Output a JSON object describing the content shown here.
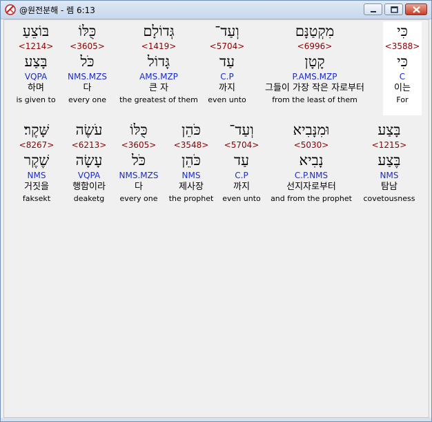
{
  "window": {
    "title": "@원전분해 - 렘 6:13"
  },
  "rows": [
    {
      "words": [
        {
          "heb": "כִּי",
          "strong": "<3588>",
          "lemma": "כִּי",
          "morph": "C",
          "kor": "이는",
          "eng": "For",
          "selected": true
        },
        {
          "heb": "מִקְטַנָּם",
          "strong": "<6996>",
          "lemma": "קָטָן",
          "morph": "P.AMS.MZP",
          "kor": "그들이 가장 작은 자로부터",
          "eng": "from the least of them",
          "selected": false
        },
        {
          "heb": "וְעַד־",
          "strong": "<5704>",
          "lemma": "עַד",
          "morph": "C.P",
          "kor": "까지",
          "eng": "even unto",
          "selected": false
        },
        {
          "heb": "גְּדוֹלָם",
          "strong": "<1419>",
          "lemma": "גָּדוֹל",
          "morph": "AMS.MZP",
          "kor": "큰 자",
          "eng": "the greatest of them",
          "selected": false
        },
        {
          "heb": "כֻּלּוֹ",
          "strong": "<3605>",
          "lemma": "כֹּל",
          "morph": "NMS.MZS",
          "kor": "다",
          "eng": "every one",
          "selected": false
        },
        {
          "heb": "בּוֹצֵעַ",
          "strong": "<1214>",
          "lemma": "בָּצַע",
          "morph": "VQPA",
          "kor": "하며",
          "eng": "is given to",
          "selected": false
        }
      ]
    },
    {
      "words": [
        {
          "heb": "בָּצַע",
          "strong": "<1215>",
          "lemma": "בֶּצַע",
          "morph": "NMS",
          "kor": "탐남",
          "eng": "covetousness",
          "selected": false
        },
        {
          "heb": "וּמִנָּבִיא",
          "strong": "<5030>",
          "lemma": "נָבִיא",
          "morph": "C.P.NMS",
          "kor": "선지자로부터",
          "eng": "and from the prophet",
          "selected": false
        },
        {
          "heb": "וְעַד־",
          "strong": "<5704>",
          "lemma": "עַד",
          "morph": "C.P",
          "kor": "까지",
          "eng": "even unto",
          "selected": false
        },
        {
          "heb": "כֹּהֵן",
          "strong": "<3548>",
          "lemma": "כֹּהֵן",
          "morph": "NMS",
          "kor": "제사장",
          "eng": "the prophet",
          "selected": false
        },
        {
          "heb": "כֻּלּוֹ",
          "strong": "<3605>",
          "lemma": "כֹּל",
          "morph": "NMS.MZS",
          "kor": "다",
          "eng": "every one",
          "selected": false
        },
        {
          "heb": "עֹשֶׂה",
          "strong": "<6213>",
          "lemma": "עָשָׂה",
          "morph": "VQPA",
          "kor": "행함이라",
          "eng": "deaketg",
          "selected": false
        },
        {
          "heb": "שָּׁקֶר׃",
          "strong": "<8267>",
          "lemma": "שֶׁקֶר",
          "morph": "NMS",
          "kor": "거짓을",
          "eng": "faksekt",
          "selected": false
        }
      ]
    }
  ]
}
